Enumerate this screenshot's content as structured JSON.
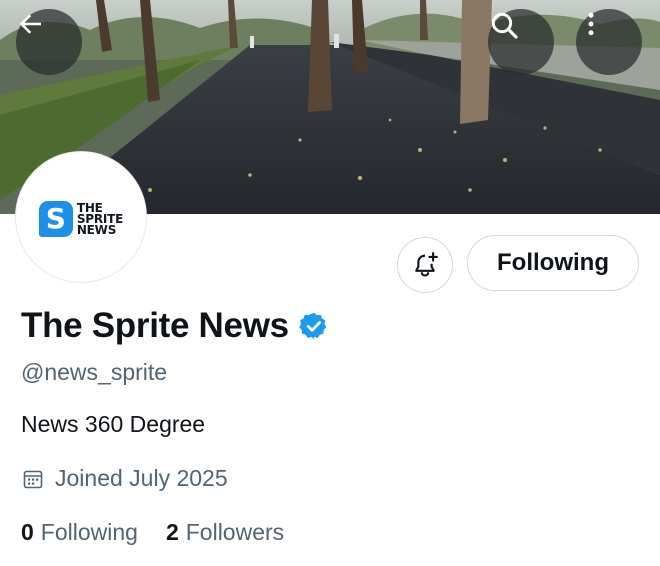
{
  "header": {
    "back_icon": "arrow-left-icon",
    "search_icon": "search-icon",
    "more_icon": "more-vertical-icon"
  },
  "avatar": {
    "logo_letter": "S",
    "logo_lines": [
      "THE",
      "SPRITE",
      "NEWS"
    ],
    "logo_color": "#1d8fe6"
  },
  "actions": {
    "notify_icon": "bell-plus-icon",
    "follow_label": "Following"
  },
  "profile": {
    "display_name": "The Sprite News",
    "verified_icon": "verified-badge-icon",
    "verified_color": "#1d9bf0",
    "handle": "@news_sprite",
    "bio": "News 360 Degree",
    "joined_icon": "calendar-icon",
    "joined": "Joined July 2025"
  },
  "stats": {
    "following_count": "0",
    "following_label": "Following",
    "followers_count": "2",
    "followers_label": "Followers"
  }
}
